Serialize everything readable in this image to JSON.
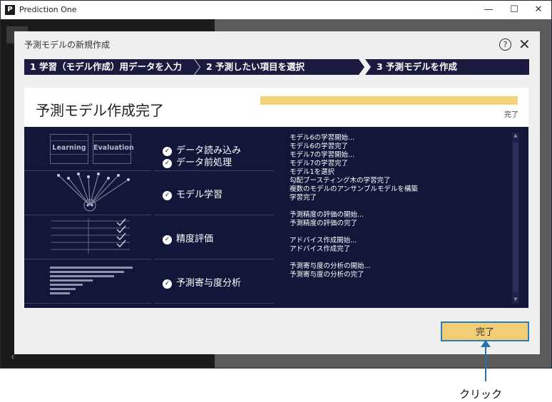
{
  "window": {
    "app_icon": "P",
    "title": "Prediction One",
    "minimize": "—",
    "maximize": "☐",
    "close": "✕"
  },
  "dialog": {
    "title": "予測モデルの新規作成",
    "help": "?",
    "close": "✕",
    "steps": [
      "1 学習（モデル作成）用データを入力",
      "2 予測したい項目を選択",
      "3 予測モデルを作成"
    ],
    "heading": "予測モデル作成完了",
    "progress": {
      "value": 1.0,
      "label": "完了"
    },
    "illustrations": {
      "learning": "Learning",
      "evaluation": "Evaluation"
    },
    "stages": [
      [
        "データ読み込み",
        "データ前処理"
      ],
      [
        "モデル学習"
      ],
      [
        "精度評価"
      ],
      [
        "予測寄与度分析"
      ]
    ],
    "log": [
      "モデル6の学習開始...",
      "モデル6の学習完了",
      "モデル7の学習開始...",
      "モデル7の学習完了",
      "モデル1を選択",
      "勾配ブースティング木の学習完了",
      "複数のモデルのアンサンブルモデルを構築",
      "学習完了",
      "",
      "予測精度の評価の開始...",
      "予測精度の評価の完了",
      "",
      "アドバイス作成開始...",
      "アドバイス作成完了",
      "",
      "予測寄与度の分析の開始...",
      "予測寄与度の分析の完了"
    ],
    "done_button": "完了"
  },
  "annotation": {
    "label": "クリック"
  },
  "colors": {
    "accent": "#f2cd76",
    "dark_panel": "#12173a",
    "step_bar": "#1a1b3e",
    "highlight_border": "#2a7fb8"
  }
}
